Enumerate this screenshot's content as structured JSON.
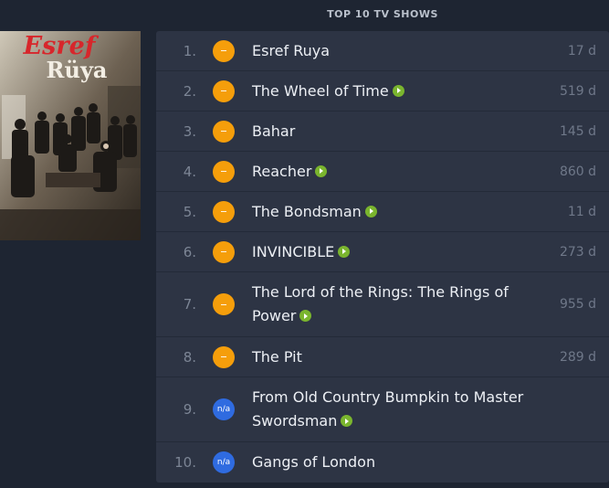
{
  "heading": "TOP 10 TV SHOWS",
  "poster": {
    "logo_line1": "Esref",
    "logo_line2": "Rüya"
  },
  "shows": [
    {
      "rank": "1.",
      "badge": "",
      "badge_color": "#f59e0b",
      "title": "Esref Ruya",
      "play": false,
      "days": "17 d"
    },
    {
      "rank": "2.",
      "badge": "",
      "badge_color": "#f59e0b",
      "title": "The Wheel of Time",
      "play": true,
      "days": "519 d"
    },
    {
      "rank": "3.",
      "badge": "",
      "badge_color": "#f59e0b",
      "title": "Bahar",
      "play": false,
      "days": "145 d"
    },
    {
      "rank": "4.",
      "badge": "",
      "badge_color": "#f59e0b",
      "title": "Reacher",
      "play": true,
      "days": "860 d"
    },
    {
      "rank": "5.",
      "badge": "",
      "badge_color": "#f59e0b",
      "title": "The Bondsman",
      "play": true,
      "days": "11 d"
    },
    {
      "rank": "6.",
      "badge": "",
      "badge_color": "#f59e0b",
      "title": "INVINCIBLE",
      "play": true,
      "days": "273 d"
    },
    {
      "rank": "7.",
      "badge": "",
      "badge_color": "#f59e0b",
      "title": "The Lord of the Rings: The Rings of Power",
      "play": true,
      "days": "955 d"
    },
    {
      "rank": "8.",
      "badge": "",
      "badge_color": "#f59e0b",
      "title": "The Pit",
      "play": false,
      "days": "289 d"
    },
    {
      "rank": "9.",
      "badge": "n/a",
      "badge_color": "#2f6be0",
      "title": "From Old Country Bumpkin to Master Swordsman",
      "play": true,
      "days": ""
    },
    {
      "rank": "10.",
      "badge": "n/a",
      "badge_color": "#2f6be0",
      "title": "Gangs of London",
      "play": false,
      "days": ""
    }
  ]
}
